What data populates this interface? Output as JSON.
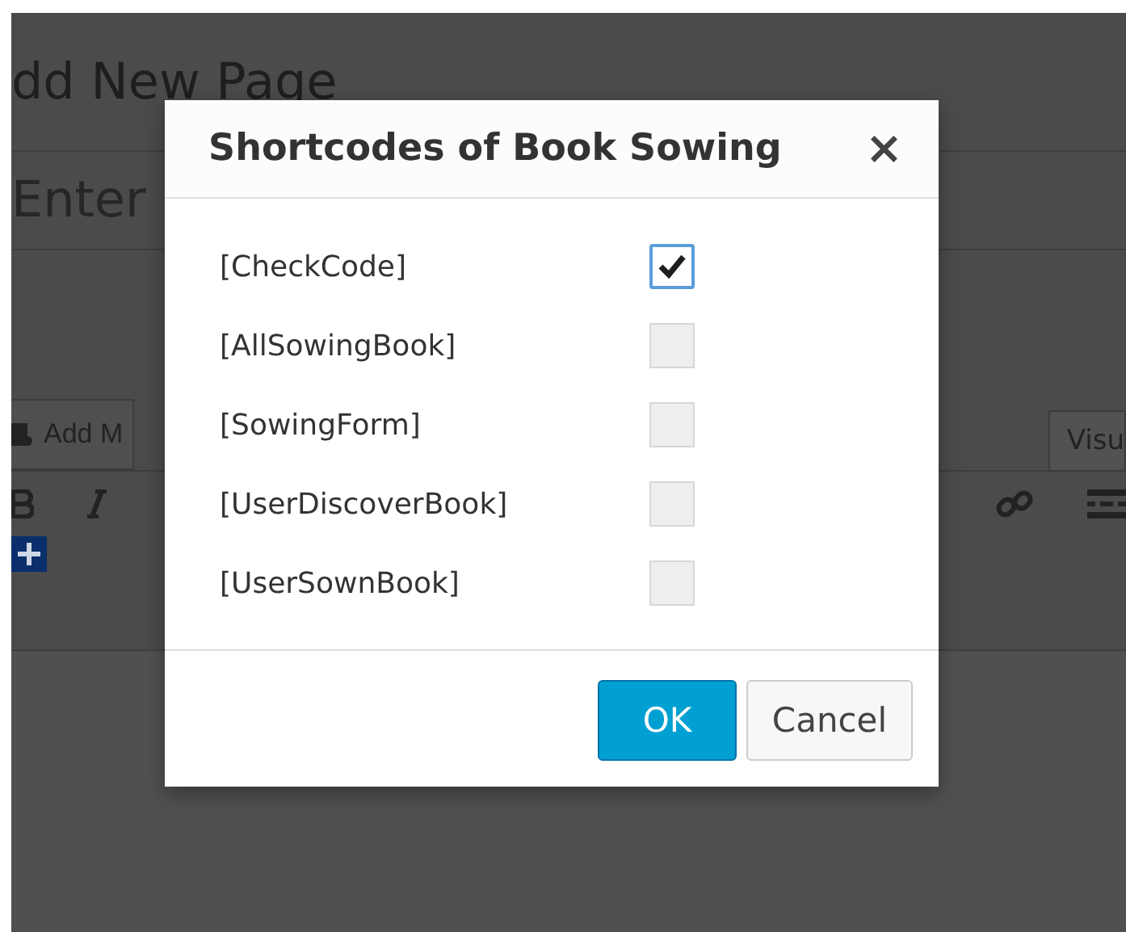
{
  "page": {
    "heading": "dd New Page",
    "title_field": {
      "placeholder": "Enter"
    },
    "add_media_button": "Add M",
    "editor_tab": "Visu"
  },
  "dialog": {
    "title": "Shortcodes of Book Sowing",
    "close": "×",
    "shortcodes": [
      {
        "label": "[CheckCode]",
        "checked": true
      },
      {
        "label": "[AllSowingBook]",
        "checked": false
      },
      {
        "label": "[SowingForm]",
        "checked": false
      },
      {
        "label": "[UserDiscoverBook]",
        "checked": false
      },
      {
        "label": "[UserSownBook]",
        "checked": false
      }
    ],
    "buttons": [
      {
        "label": "OK",
        "kind": "primary"
      },
      {
        "label": "Cancel",
        "kind": "secondary"
      }
    ]
  }
}
